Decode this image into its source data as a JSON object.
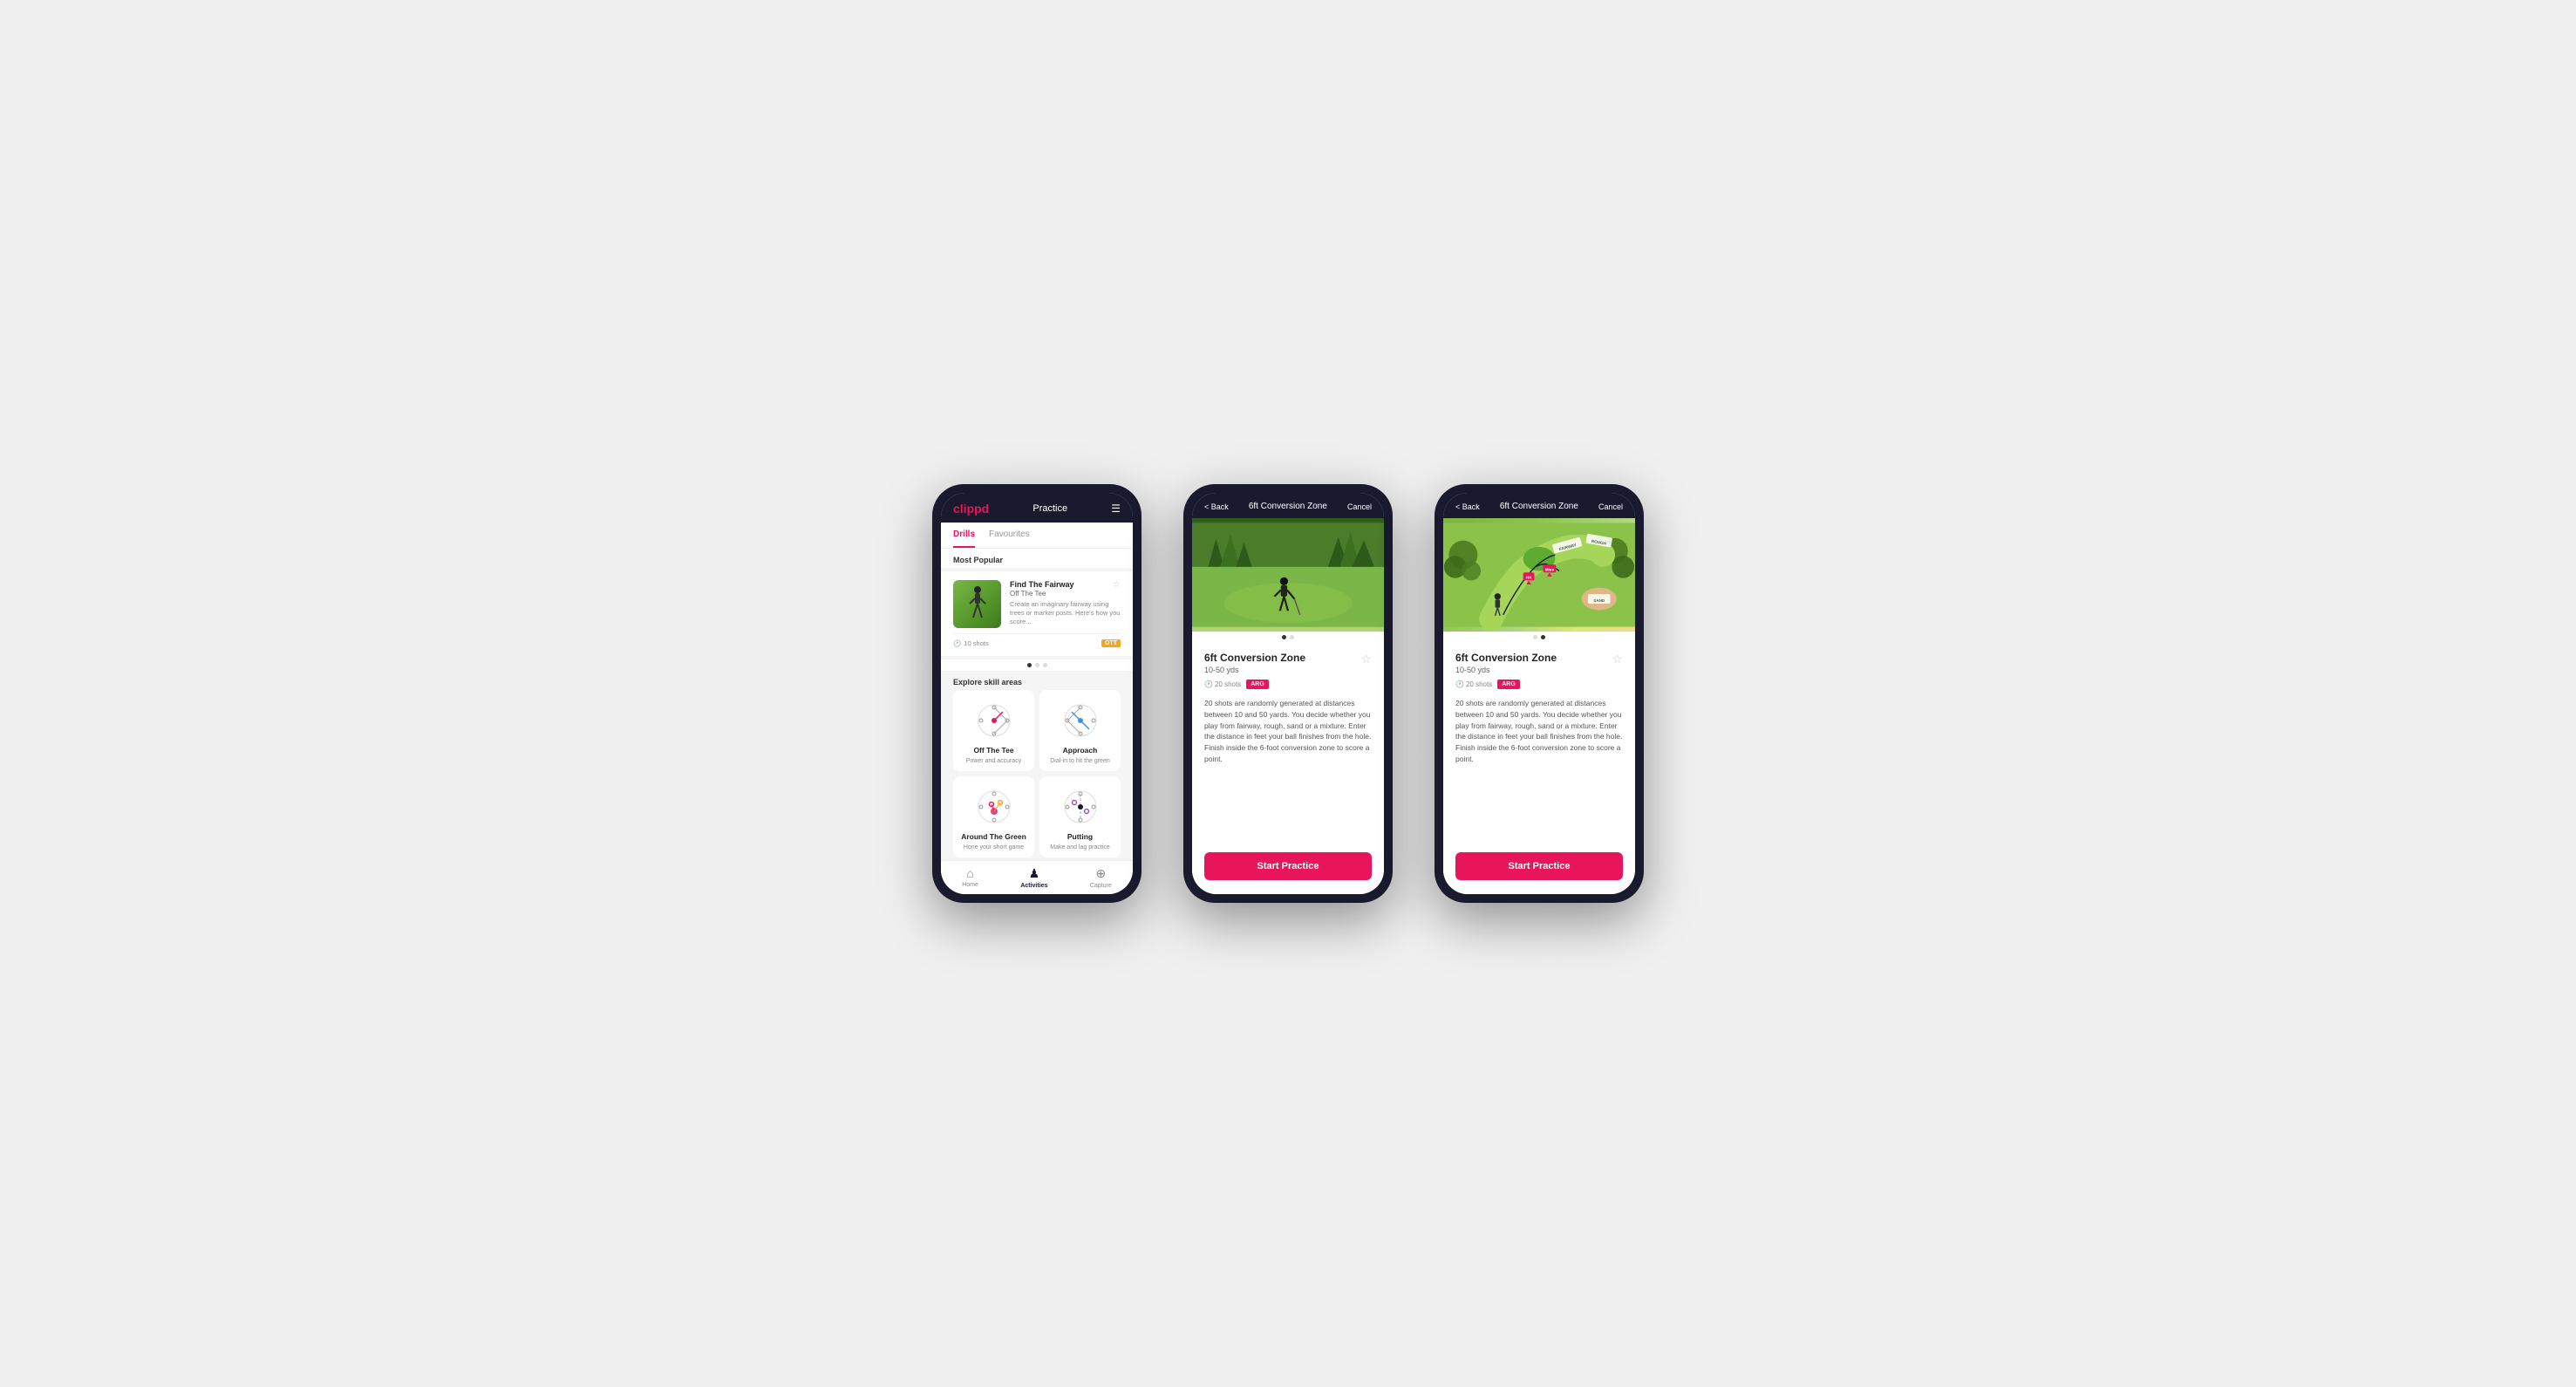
{
  "app": {
    "name": "clippd"
  },
  "phone1": {
    "header": {
      "logo": "clippd",
      "title": "Practice",
      "menu_icon": "☰"
    },
    "tabs": [
      {
        "label": "Drills",
        "active": true
      },
      {
        "label": "Favourites",
        "active": false
      }
    ],
    "most_popular_label": "Most Popular",
    "featured_drill": {
      "title": "Find The Fairway",
      "subtitle": "Off The Tee",
      "description": "Create an imaginary fairway using trees or marker posts. Here's how you score...",
      "shots": "10 shots",
      "badge": "OTT"
    },
    "explore_label": "Explore skill areas",
    "skill_areas": [
      {
        "name": "Off The Tee",
        "desc": "Power and accuracy"
      },
      {
        "name": "Approach",
        "desc": "Dial-in to hit the green"
      },
      {
        "name": "Around The Green",
        "desc": "Hone your short game"
      },
      {
        "name": "Putting",
        "desc": "Make and lag practice"
      }
    ],
    "bottom_nav": [
      {
        "label": "Home",
        "icon": "⌂",
        "active": false
      },
      {
        "label": "Activities",
        "icon": "♟",
        "active": true
      },
      {
        "label": "Capture",
        "icon": "⊕",
        "active": false
      }
    ]
  },
  "phone2": {
    "header": {
      "back_label": "< Back",
      "title": "6ft Conversion Zone",
      "cancel_label": "Cancel"
    },
    "drill": {
      "title": "6ft Conversion Zone",
      "range": "10-50 yds",
      "shots": "20 shots",
      "badge": "ARG",
      "description": "20 shots are randomly generated at distances between 10 and 50 yards. You decide whether you play from fairway, rough, sand or a mixture. Enter the distance in feet your ball finishes from the hole. Finish inside the 6-foot conversion zone to score a point."
    },
    "start_button": "Start Practice"
  },
  "phone3": {
    "header": {
      "back_label": "< Back",
      "title": "6ft Conversion Zone",
      "cancel_label": "Cancel"
    },
    "drill": {
      "title": "6ft Conversion Zone",
      "range": "10-50 yds",
      "shots": "20 shots",
      "badge": "ARG",
      "description": "20 shots are randomly generated at distances between 10 and 50 yards. You decide whether you play from fairway, rough, sand or a mixture. Enter the distance in feet your ball finishes from the hole. Finish inside the 6-foot conversion zone to score a point."
    },
    "start_button": "Start Practice"
  }
}
